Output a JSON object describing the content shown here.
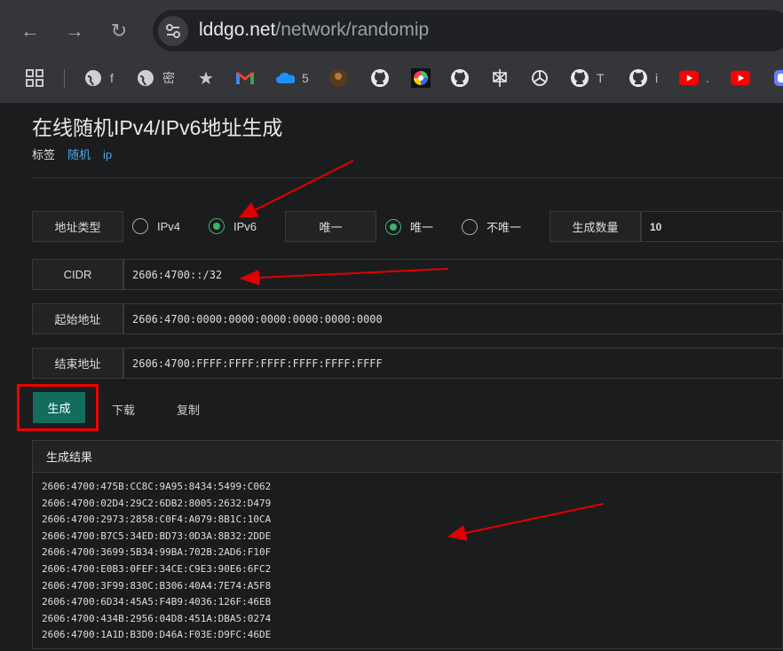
{
  "browser": {
    "url_host": "lddgo.net",
    "url_path": "/network/randomip",
    "bookmarks": [
      {
        "icon": "globe-icon",
        "label": "f"
      },
      {
        "icon": "globe-icon",
        "label": "密"
      },
      {
        "icon": "star-icon",
        "label": ""
      },
      {
        "icon": "gmail-icon",
        "label": ""
      },
      {
        "icon": "onedrive-icon",
        "label": "5"
      },
      {
        "icon": "avatar-icon",
        "label": ""
      },
      {
        "icon": "github-icon",
        "label": ""
      },
      {
        "icon": "color-wheel-icon",
        "label": ""
      },
      {
        "icon": "github-icon",
        "label": ""
      },
      {
        "icon": "perplexity-icon",
        "label": ""
      },
      {
        "icon": "openai-icon",
        "label": ""
      },
      {
        "icon": "github-icon",
        "label": "T"
      },
      {
        "icon": "github-icon",
        "label": "i"
      },
      {
        "icon": "youtube-icon",
        "label": "."
      },
      {
        "icon": "youtube-icon",
        "label": ""
      }
    ]
  },
  "page": {
    "title": "在线随机IPv4/IPv6地址生成",
    "tags_label": "标签",
    "tags": [
      "随机",
      "ip"
    ]
  },
  "form": {
    "address_type_label": "地址类型",
    "ipv4_label": "IPv4",
    "ipv6_label": "IPv6",
    "selected_type": "IPv6",
    "unique_label": "唯一",
    "unique_option": "唯一",
    "not_unique_option": "不唯一",
    "selected_unique": "唯一",
    "count_label": "生成数量",
    "count_value": "10",
    "cidr_label": "CIDR",
    "cidr_value": "2606:4700::/32",
    "start_label": "起始地址",
    "start_value": "2606:4700:0000:0000:0000:0000:0000:0000",
    "end_label": "结束地址",
    "end_value": "2606:4700:FFFF:FFFF:FFFF:FFFF:FFFF:FFFF"
  },
  "actions": {
    "generate": "生成",
    "download": "下载",
    "copy": "复制"
  },
  "results": {
    "title": "生成结果",
    "lines": [
      "2606:4700:475B:CC8C:9A95:8434:5499:C062",
      "2606:4700:02D4:29C2:6DB2:8005:2632:D479",
      "2606:4700:2973:2858:C0F4:A079:8B1C:10CA",
      "2606:4700:B7C5:34ED:BD73:0D3A:8B32:2DDE",
      "2606:4700:3699:5B34:99BA:702B:2AD6:F10F",
      "2606:4700:E0B3:0FEF:34CE:C9E3:90E6:6FC2",
      "2606:4700:3F99:830C:B306:40A4:7E74:A5F8",
      "2606:4700:6D34:45A5:F4B9:4036:126F:46EB",
      "2606:4700:434B:2956:04D8:451A:DBA5:0274",
      "2606:4700:1A1D:B3D0:D46A:F03E:D9FC:46DE"
    ]
  },
  "colors": {
    "accent_green": "#136d5e",
    "link_blue": "#4aa7e6",
    "annotation_red": "#e00000"
  }
}
